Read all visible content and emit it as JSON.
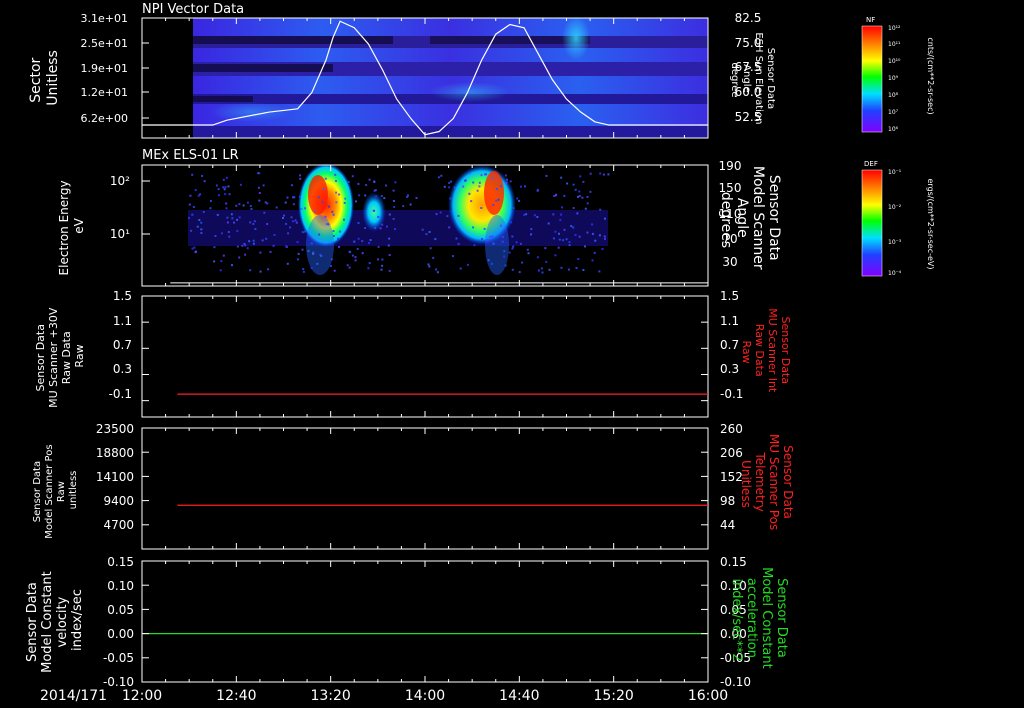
{
  "time_axis": {
    "date_label": "2014/171",
    "ticks": [
      "12:00",
      "12:40",
      "13:20",
      "14:00",
      "14:40",
      "15:20",
      "16:00"
    ],
    "tick_hours": [
      12.0,
      12.6667,
      13.3333,
      14.0,
      14.6667,
      15.3333,
      16.0
    ],
    "range_hours": [
      12.0,
      16.0
    ]
  },
  "chart_data": [
    {
      "type": "heatmap",
      "title": "NPI Vector Data",
      "ylabel_lines": [
        "Sector",
        "Unitless"
      ],
      "yticks": [
        "3.1e+01",
        "2.5e+01",
        "1.9e+01",
        "1.2e+01",
        "6.2e+00"
      ],
      "right_label_lines": [
        "Sensor Data",
        "ESH Sun Elevation",
        "Angle",
        "degree"
      ],
      "right_ticks": [
        "82.5",
        "75.0",
        "67.5",
        "60.0",
        "52.5"
      ],
      "right_ylim": [
        46,
        83
      ],
      "overlay_line": {
        "color": "#ffffff",
        "x_hours": [
          12.0,
          12.5,
          12.6,
          12.9,
          13.1,
          13.2,
          13.3,
          13.35,
          13.4,
          13.5,
          13.6,
          13.7,
          13.8,
          13.9,
          14.0,
          14.1,
          14.2,
          14.3,
          14.4,
          14.5,
          14.6,
          14.7,
          14.8,
          14.9,
          15.0,
          15.1,
          15.2,
          15.3,
          15.4,
          16.0
        ],
        "y_values": [
          50,
          50,
          51.5,
          54,
          55,
          60,
          70,
          77,
          82,
          80,
          75,
          67,
          58,
          52,
          47,
          48,
          52,
          60,
          70,
          78,
          81,
          80,
          72,
          64,
          58,
          54,
          51,
          50,
          50,
          50
        ]
      },
      "colorbar": {
        "label": "NF",
        "units": "cnts/(cm**2-sr-sec)",
        "ticks": [
          "10¹²",
          "10¹¹",
          "10¹⁰",
          "10⁹",
          "10⁸",
          "10⁷",
          "10⁶"
        ]
      }
    },
    {
      "type": "heatmap",
      "title": "MEx ELS-01 LR",
      "ylabel_lines": [
        "Electron Energy",
        "eV"
      ],
      "yticks": [
        "10²",
        "10¹"
      ],
      "right_label_lines": [
        "Sensor Data",
        "Model Scanner",
        "Angle",
        "degrees"
      ],
      "right_ticks": [
        "190",
        "150",
        "110",
        "70",
        "30"
      ],
      "right_ylim": [
        0,
        190
      ],
      "overlay_line": {
        "color": "#ffffff",
        "x_hours": [
          12.2,
          16.0
        ],
        "y_values": [
          5,
          5
        ]
      },
      "colorbar": {
        "label": "DEF",
        "units": "ergs/(cm**2-sr-sec-eV)",
        "ticks": [
          "10⁻¹",
          "10⁻²",
          "10⁻³",
          "10⁻⁴"
        ]
      }
    },
    {
      "type": "line",
      "ylabel_lines": [
        "Sensor Data",
        "MU Scanner +30V",
        "Raw Data",
        "Raw"
      ],
      "yticks": [
        "1.5",
        "1.1",
        "0.7",
        "0.3",
        "-0.1"
      ],
      "ytick_values": [
        1.5,
        1.1,
        0.7,
        0.3,
        -0.1
      ],
      "ylim": [
        -0.35,
        1.5
      ],
      "right_label_lines": [
        "Sensor Data",
        "MU Scanner Int",
        "Raw Data",
        "Raw"
      ],
      "right_label_color": "#ff2020",
      "right_ticks": [
        "1.5",
        "1.1",
        "0.7",
        "0.3",
        "-0.1"
      ],
      "series": [
        {
          "color": "#ff2020",
          "x_hours": [
            12.25,
            16.0
          ],
          "y_values": [
            0.0,
            0.0
          ]
        }
      ]
    },
    {
      "type": "line",
      "ylabel_lines": [
        "Sensor Data",
        "Model Scanner Pos",
        "Raw",
        "unitless"
      ],
      "yticks": [
        "23500",
        "18800",
        "14100",
        "9400",
        "4700"
      ],
      "ytick_values": [
        23500,
        18800,
        14100,
        9400,
        4700
      ],
      "ylim": [
        0,
        23500
      ],
      "right_label_lines": [
        "Sensor Data",
        "MU Scanner Pos",
        "Telemetry",
        "Unitless"
      ],
      "right_label_color": "#ff2020",
      "right_ticks": [
        "260",
        "206",
        "152",
        "98",
        "44"
      ],
      "series": [
        {
          "color": "#ff2020",
          "x_hours": [
            12.25,
            16.0
          ],
          "y_values": [
            8500,
            8500
          ]
        }
      ]
    },
    {
      "type": "line",
      "ylabel_lines": [
        "Sensor Data",
        "Model Constant",
        "velocity",
        "index/sec"
      ],
      "yticks": [
        "0.15",
        "0.10",
        "0.05",
        "0.00",
        "-0.05",
        "-0.10"
      ],
      "ytick_values": [
        0.15,
        0.1,
        0.05,
        0.0,
        -0.05,
        -0.1
      ],
      "ylim": [
        -0.1,
        0.15
      ],
      "right_label_lines": [
        "Sensor Data",
        "Model Constant",
        "acceleration",
        "index/sec**2"
      ],
      "right_label_color": "#22dd22",
      "right_ticks": [
        "0.15",
        "0.10",
        "0.05",
        "0.00",
        "-0.05",
        "-0.10"
      ],
      "series": [
        {
          "color": "#22dd22",
          "x_hours": [
            12.0,
            16.0
          ],
          "y_values": [
            0.0,
            0.0
          ]
        }
      ]
    }
  ]
}
